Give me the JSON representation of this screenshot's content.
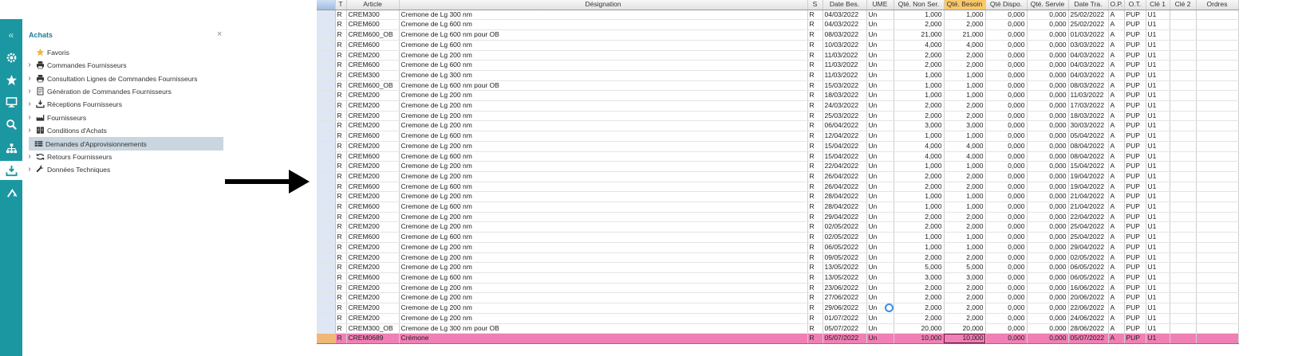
{
  "sidebar": {
    "collapse_glyph": "«",
    "buttons": [
      {
        "icon": "gear-icon"
      },
      {
        "icon": "star-icon"
      },
      {
        "icon": "monitor-icon"
      },
      {
        "icon": "search-icon"
      },
      {
        "icon": "hierarchy-icon"
      },
      {
        "icon": "download-icon"
      },
      {
        "icon": "return-icon"
      }
    ]
  },
  "panel": {
    "title": "Achats",
    "close_glyph": "×",
    "items": [
      {
        "label": "Favoris",
        "icon": "star-icon",
        "expandable": false
      },
      {
        "label": "Commandes Fournisseurs",
        "icon": "printer-icon",
        "expandable": true
      },
      {
        "label": "Consultation Lignes de Commandes Fournisseurs",
        "icon": "printer-icon",
        "expandable": true
      },
      {
        "label": "Génération de Commandes Fournisseurs",
        "icon": "document-icon",
        "expandable": true
      },
      {
        "label": "Réceptions Fournisseurs",
        "icon": "download-icon",
        "expandable": true
      },
      {
        "label": "Fournisseurs",
        "icon": "factory-icon",
        "expandable": true
      },
      {
        "label": "Conditions d'Achats",
        "icon": "ledger-icon",
        "expandable": true
      },
      {
        "label": "Demandes d'Approvisionnements",
        "icon": "table-icon",
        "expandable": false,
        "selected": true
      },
      {
        "label": "Retours Fournisseurs",
        "icon": "return-arrows-icon",
        "expandable": true
      },
      {
        "label": "Données Techniques",
        "icon": "wrench-icon",
        "expandable": true
      }
    ]
  },
  "grid": {
    "headers": [
      "",
      "T",
      "Article",
      "Désignation",
      "S",
      "Date Bes.",
      "UME",
      "Qté. Non Ser.",
      "Qté. Besoin",
      "Qté Dispo.",
      "Qté. Servie",
      "Date Tra.",
      "O.P.",
      "O.T.",
      "Clé 1",
      "Clé 2",
      "Ordres"
    ],
    "sorted_header_index": 8,
    "rows": [
      [
        "R",
        "CREM300",
        "Cremone de Lg 300 nm",
        "R",
        "04/03/2022",
        "Un",
        "1,000",
        "1,000",
        "0,000",
        "0,000",
        "25/02/2022",
        "A",
        "PUP",
        "U1"
      ],
      [
        "R",
        "CREM600",
        "Cremone de Lg 600 nm",
        "R",
        "04/03/2022",
        "Un",
        "2,000",
        "2,000",
        "0,000",
        "0,000",
        "25/02/2022",
        "A",
        "PUP",
        "U1"
      ],
      [
        "R",
        "CREM600_OB",
        "Cremone de Lg 600 nm pour OB",
        "R",
        "08/03/2022",
        "Un",
        "21,000",
        "21,000",
        "0,000",
        "0,000",
        "01/03/2022",
        "A",
        "PUP",
        "U1"
      ],
      [
        "R",
        "CREM600",
        "Cremone de Lg 600 nm",
        "R",
        "10/03/2022",
        "Un",
        "4,000",
        "4,000",
        "0,000",
        "0,000",
        "03/03/2022",
        "A",
        "PUP",
        "U1"
      ],
      [
        "R",
        "CREM200",
        "Cremone de Lg 200 nm",
        "R",
        "11/03/2022",
        "Un",
        "2,000",
        "2,000",
        "0,000",
        "0,000",
        "04/03/2022",
        "A",
        "PUP",
        "U1"
      ],
      [
        "R",
        "CREM600",
        "Cremone de Lg 600 nm",
        "R",
        "11/03/2022",
        "Un",
        "2,000",
        "2,000",
        "0,000",
        "0,000",
        "04/03/2022",
        "A",
        "PUP",
        "U1"
      ],
      [
        "R",
        "CREM300",
        "Cremone de Lg 300 nm",
        "R",
        "11/03/2022",
        "Un",
        "1,000",
        "1,000",
        "0,000",
        "0,000",
        "04/03/2022",
        "A",
        "PUP",
        "U1"
      ],
      [
        "R",
        "CREM600_OB",
        "Cremone de Lg 600 nm pour OB",
        "R",
        "15/03/2022",
        "Un",
        "1,000",
        "1,000",
        "0,000",
        "0,000",
        "08/03/2022",
        "A",
        "PUP",
        "U1"
      ],
      [
        "R",
        "CREM200",
        "Cremone de Lg 200 nm",
        "R",
        "18/03/2022",
        "Un",
        "1,000",
        "1,000",
        "0,000",
        "0,000",
        "11/03/2022",
        "A",
        "PUP",
        "U1"
      ],
      [
        "R",
        "CREM200",
        "Cremone de Lg 200 nm",
        "R",
        "24/03/2022",
        "Un",
        "2,000",
        "2,000",
        "0,000",
        "0,000",
        "17/03/2022",
        "A",
        "PUP",
        "U1"
      ],
      [
        "R",
        "CREM200",
        "Cremone de Lg 200 nm",
        "R",
        "25/03/2022",
        "Un",
        "2,000",
        "2,000",
        "0,000",
        "0,000",
        "18/03/2022",
        "A",
        "PUP",
        "U1"
      ],
      [
        "R",
        "CREM200",
        "Cremone de Lg 200 nm",
        "R",
        "06/04/2022",
        "Un",
        "3,000",
        "3,000",
        "0,000",
        "0,000",
        "30/03/2022",
        "A",
        "PUP",
        "U1"
      ],
      [
        "R",
        "CREM600",
        "Cremone de Lg 600 nm",
        "R",
        "12/04/2022",
        "Un",
        "1,000",
        "1,000",
        "0,000",
        "0,000",
        "05/04/2022",
        "A",
        "PUP",
        "U1"
      ],
      [
        "R",
        "CREM200",
        "Cremone de Lg 200 nm",
        "R",
        "15/04/2022",
        "Un",
        "4,000",
        "4,000",
        "0,000",
        "0,000",
        "08/04/2022",
        "A",
        "PUP",
        "U1"
      ],
      [
        "R",
        "CREM600",
        "Cremone de Lg 600 nm",
        "R",
        "15/04/2022",
        "Un",
        "4,000",
        "4,000",
        "0,000",
        "0,000",
        "08/04/2022",
        "A",
        "PUP",
        "U1"
      ],
      [
        "R",
        "CREM200",
        "Cremone de Lg 200 nm",
        "R",
        "22/04/2022",
        "Un",
        "1,000",
        "1,000",
        "0,000",
        "0,000",
        "15/04/2022",
        "A",
        "PUP",
        "U1"
      ],
      [
        "R",
        "CREM200",
        "Cremone de Lg 200 nm",
        "R",
        "26/04/2022",
        "Un",
        "2,000",
        "2,000",
        "0,000",
        "0,000",
        "19/04/2022",
        "A",
        "PUP",
        "U1"
      ],
      [
        "R",
        "CREM600",
        "Cremone de Lg 600 nm",
        "R",
        "26/04/2022",
        "Un",
        "2,000",
        "2,000",
        "0,000",
        "0,000",
        "19/04/2022",
        "A",
        "PUP",
        "U1"
      ],
      [
        "R",
        "CREM200",
        "Cremone de Lg 200 nm",
        "R",
        "28/04/2022",
        "Un",
        "1,000",
        "1,000",
        "0,000",
        "0,000",
        "21/04/2022",
        "A",
        "PUP",
        "U1"
      ],
      [
        "R",
        "CREM600",
        "Cremone de Lg 600 nm",
        "R",
        "28/04/2022",
        "Un",
        "1,000",
        "1,000",
        "0,000",
        "0,000",
        "21/04/2022",
        "A",
        "PUP",
        "U1"
      ],
      [
        "R",
        "CREM200",
        "Cremone de Lg 200 nm",
        "R",
        "29/04/2022",
        "Un",
        "2,000",
        "2,000",
        "0,000",
        "0,000",
        "22/04/2022",
        "A",
        "PUP",
        "U1"
      ],
      [
        "R",
        "CREM200",
        "Cremone de Lg 200 nm",
        "R",
        "02/05/2022",
        "Un",
        "2,000",
        "2,000",
        "0,000",
        "0,000",
        "25/04/2022",
        "A",
        "PUP",
        "U1"
      ],
      [
        "R",
        "CREM600",
        "Cremone de Lg 600 nm",
        "R",
        "02/05/2022",
        "Un",
        "1,000",
        "1,000",
        "0,000",
        "0,000",
        "25/04/2022",
        "A",
        "PUP",
        "U1"
      ],
      [
        "R",
        "CREM200",
        "Cremone de Lg 200 nm",
        "R",
        "06/05/2022",
        "Un",
        "1,000",
        "1,000",
        "0,000",
        "0,000",
        "29/04/2022",
        "A",
        "PUP",
        "U1"
      ],
      [
        "R",
        "CREM200",
        "Cremone de Lg 200 nm",
        "R",
        "09/05/2022",
        "Un",
        "2,000",
        "2,000",
        "0,000",
        "0,000",
        "02/05/2022",
        "A",
        "PUP",
        "U1"
      ],
      [
        "R",
        "CREM200",
        "Cremone de Lg 200 nm",
        "R",
        "13/05/2022",
        "Un",
        "5,000",
        "5,000",
        "0,000",
        "0,000",
        "06/05/2022",
        "A",
        "PUP",
        "U1"
      ],
      [
        "R",
        "CREM600",
        "Cremone de Lg 600 nm",
        "R",
        "13/05/2022",
        "Un",
        "3,000",
        "3,000",
        "0,000",
        "0,000",
        "06/05/2022",
        "A",
        "PUP",
        "U1"
      ],
      [
        "R",
        "CREM200",
        "Cremone de Lg 200 nm",
        "R",
        "23/06/2022",
        "Un",
        "2,000",
        "2,000",
        "0,000",
        "0,000",
        "16/06/2022",
        "A",
        "PUP",
        "U1"
      ],
      [
        "R",
        "CREM200",
        "Cremone de Lg 200 nm",
        "R",
        "27/06/2022",
        "Un",
        "2,000",
        "2,000",
        "0,000",
        "0,000",
        "20/06/2022",
        "A",
        "PUP",
        "U1"
      ],
      [
        "R",
        "CREM200",
        "Cremone de Lg 200 nm",
        "R",
        "29/06/2022",
        "Un",
        "2,000",
        "2,000",
        "0,000",
        "0,000",
        "22/06/2022",
        "A",
        "PUP",
        "U1"
      ],
      [
        "R",
        "CREM200",
        "Cremone de Lg 200 nm",
        "R",
        "01/07/2022",
        "Un",
        "2,000",
        "2,000",
        "0,000",
        "0,000",
        "24/06/2022",
        "A",
        "PUP",
        "U1"
      ],
      [
        "R",
        "CREM300_OB",
        "Cremone de Lg 300 nm pour OB",
        "R",
        "05/07/2022",
        "Un",
        "20,000",
        "20,000",
        "0,000",
        "0,000",
        "28/06/2022",
        "A",
        "PUP",
        "U1"
      ],
      [
        "R",
        "CREM0689",
        "Crémone",
        "R",
        "05/07/2022",
        "Un",
        "10,000",
        "10,000",
        "0,000",
        "0,000",
        "05/07/2022",
        "A",
        "PUP",
        "U1"
      ]
    ],
    "highlight_row_index": 32,
    "highlight_color": "#f07fb5"
  },
  "arrow_color": "#000000",
  "accent_color": "#1b97a2"
}
